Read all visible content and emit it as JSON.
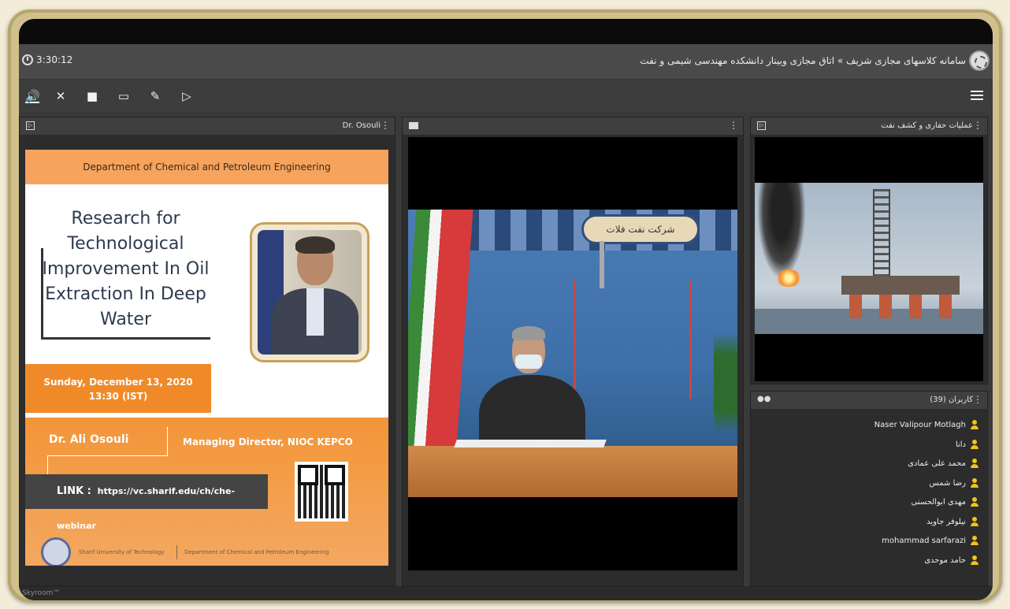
{
  "header": {
    "timer": "3:30:12",
    "title": "سامانه کلاسهای مجازی شریف » اتاق مجازی وبینار دانشکده مهندسی شیمی و نفت"
  },
  "toolbar": {
    "icons": [
      "speaker-icon",
      "mic-muted-icon",
      "camera-icon",
      "screen-share-icon",
      "brush-icon",
      "media-icon",
      "menu-icon"
    ]
  },
  "left_panel": {
    "title": "Dr. Osouli",
    "slide": {
      "top_banner": "Department of Chemical and Petroleum Engineering",
      "heading": "Research for Technological Improvement In Oil Extraction In Deep Water",
      "date_line1": "Sunday, December 13, 2020",
      "date_line2": "13:30 (IST)",
      "speaker_name": "Dr. Ali Osouli",
      "speaker_role": "Managing Director, NIOC KEPCO",
      "link_label": "LINK :",
      "link_url": "https://vc.sharif.edu/ch/che-webinar",
      "footer_univ": "Sharif University of Technology",
      "footer_dept": "Department of Chemical and Petroleum Engineering"
    }
  },
  "center_panel": {
    "banner_text": "شرکت نفت فلات"
  },
  "right_top_panel": {
    "title": "عملیات حفاری و کشف نفت"
  },
  "users_panel": {
    "title": "کاربران (39)",
    "users": [
      "Naser Valipour Motlagh",
      "دانا",
      "محمد علی عمادی",
      "رضا شمس",
      "مهدی ابوالحسنی",
      "نیلوفر جاوید",
      "mohammad sarfarazi",
      "حامد موحدی"
    ]
  },
  "footer": {
    "brand": "Skyroom™"
  }
}
